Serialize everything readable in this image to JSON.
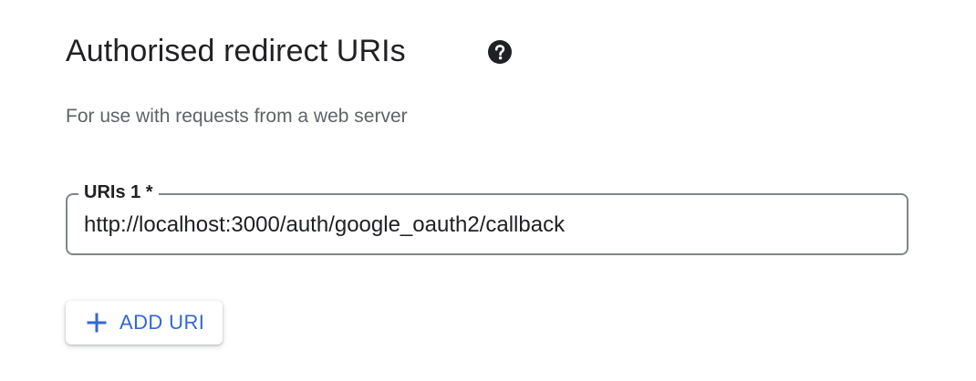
{
  "section": {
    "title": "Authorised redirect URIs",
    "help_icon": "help-circle-icon",
    "subtitle": "For use with requests from a web server"
  },
  "uris": [
    {
      "label": "URIs 1 *",
      "value": "http://localhost:3000/auth/google_oauth2/callback"
    }
  ],
  "add_button": {
    "icon": "plus-icon",
    "label": "ADD URI"
  },
  "colors": {
    "accent": "#3367d6",
    "border": "#80868b",
    "text": "#202124",
    "secondary_text": "#5f6368"
  }
}
